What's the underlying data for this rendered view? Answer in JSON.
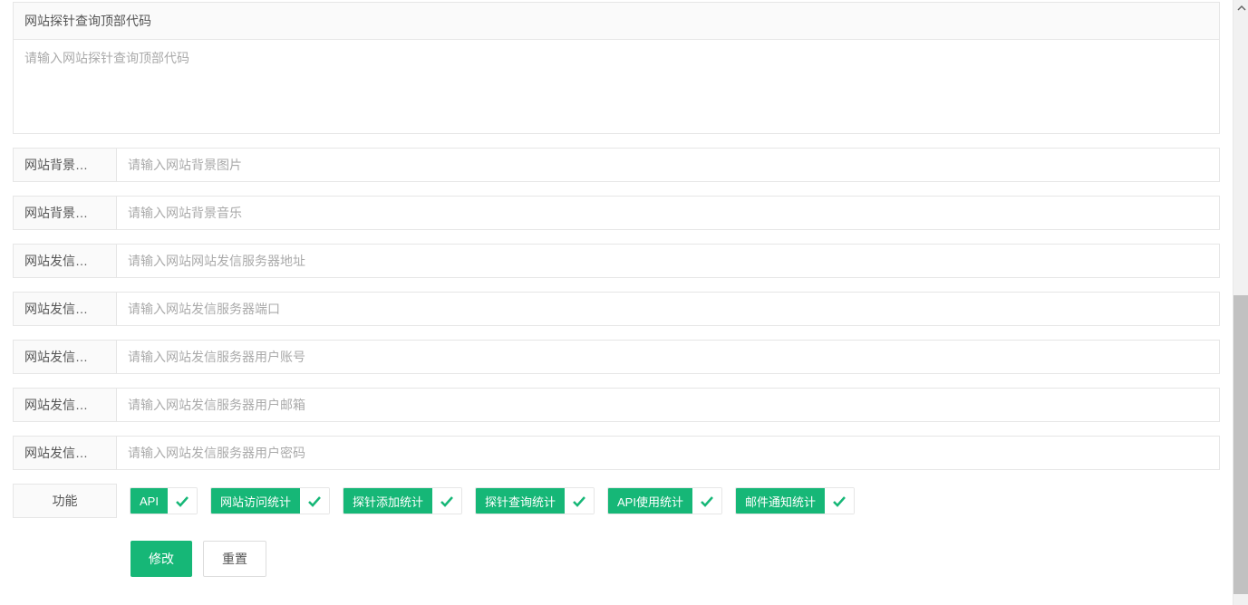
{
  "section": {
    "header": "网站探针查询顶部代码",
    "textarea_placeholder": "请输入网站探针查询顶部代码"
  },
  "fields": {
    "bg_image": {
      "label": "网站背景…",
      "placeholder": "请输入网站背景图片"
    },
    "bg_music": {
      "label": "网站背景…",
      "placeholder": "请输入网站背景音乐"
    },
    "mail_server": {
      "label": "网站发信…",
      "placeholder": "请输入网站网站发信服务器地址"
    },
    "mail_port": {
      "label": "网站发信…",
      "placeholder": "请输入网站发信服务器端口"
    },
    "mail_account": {
      "label": "网站发信…",
      "placeholder": "请输入网站发信服务器用户账号"
    },
    "mail_email": {
      "label": "网站发信…",
      "placeholder": "请输入网站发信服务器用户邮箱"
    },
    "mail_password": {
      "label": "网站发信…",
      "placeholder": "请输入网站发信服务器用户密码"
    }
  },
  "features": {
    "label": "功能",
    "items": {
      "api": "API",
      "visit_stats": "网站访问统计",
      "probe_add_stats": "探针添加统计",
      "probe_query_stats": "探针查询统计",
      "api_usage_stats": "API使用统计",
      "mail_notify_stats": "邮件通知统计"
    }
  },
  "actions": {
    "submit": "修改",
    "reset": "重置"
  }
}
